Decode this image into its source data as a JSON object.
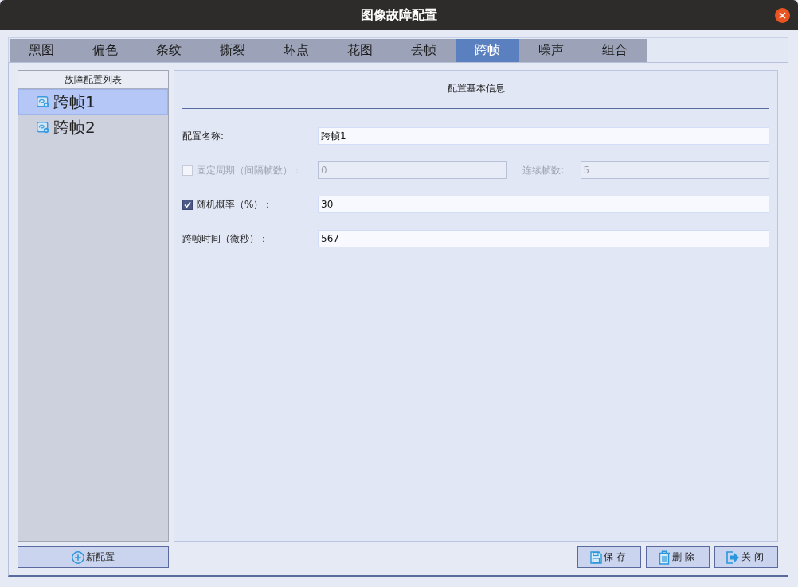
{
  "window": {
    "title": "图像故障配置"
  },
  "tabs": [
    {
      "label": "黑图",
      "selected": false
    },
    {
      "label": "偏色",
      "selected": false
    },
    {
      "label": "条纹",
      "selected": false
    },
    {
      "label": "撕裂",
      "selected": false
    },
    {
      "label": "坏点",
      "selected": false
    },
    {
      "label": "花图",
      "selected": false
    },
    {
      "label": "丢帧",
      "selected": false
    },
    {
      "label": "跨帧",
      "selected": true
    },
    {
      "label": "噪声",
      "selected": false
    },
    {
      "label": "组合",
      "selected": false
    }
  ],
  "config_list": {
    "title": "故障配置列表",
    "items": [
      {
        "label": "跨帧1",
        "selected": true
      },
      {
        "label": "跨帧2",
        "selected": false
      }
    ]
  },
  "form": {
    "title": "配置基本信息",
    "rows": [
      {
        "kind": "text",
        "label": "配置名称:",
        "value": "跨帧1",
        "disabled": false
      },
      {
        "kind": "check_pair",
        "label": "固定周期（间隔帧数）：",
        "checked": false,
        "disabled": true,
        "value": "0",
        "label_2": "连续帧数:",
        "value_2": "5"
      },
      {
        "kind": "check",
        "label": "随机概率（%）：",
        "checked": true,
        "disabled": false,
        "value": "30"
      },
      {
        "kind": "text",
        "label": "跨帧时间（微秒）：",
        "value": "567",
        "disabled": false
      }
    ]
  },
  "new_button": {
    "label": "新配置"
  },
  "actions": [
    {
      "kind": "save",
      "label": "保存"
    },
    {
      "kind": "delete",
      "label": "删除"
    },
    {
      "kind": "close",
      "label": "关闭"
    }
  ]
}
